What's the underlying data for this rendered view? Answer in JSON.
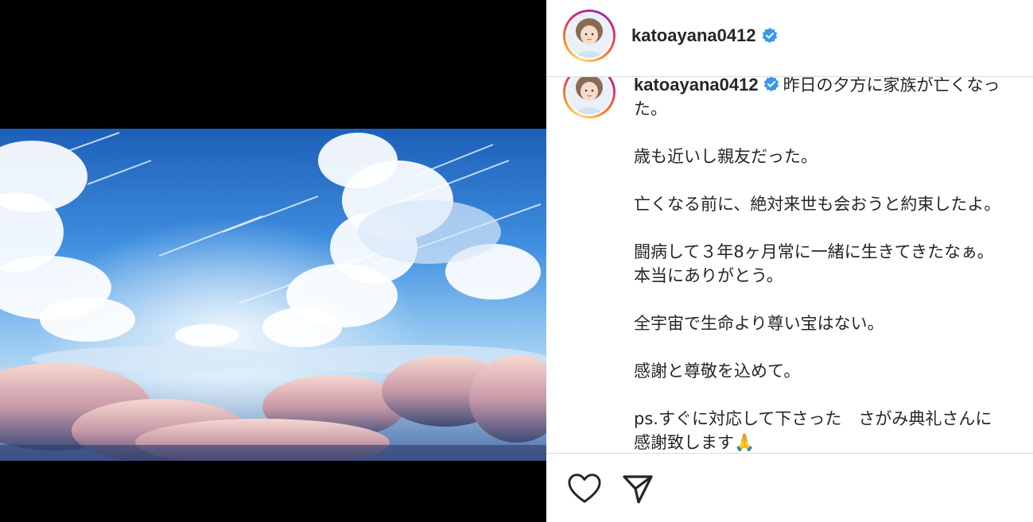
{
  "post": {
    "username": "katoayana0412",
    "verified": true,
    "caption": {
      "first_line_start": "昨日の夕方に家族が亡くなっ",
      "first_line_end": "た。",
      "paragraphs": [
        [
          "歳も近いし親友だった。"
        ],
        [
          "亡くなる前に、絶対来世も会おうと約束したよ。"
        ],
        [
          "闘病して３年8ヶ月常に一緒に生きてきたなぁ。",
          "本当にありがとう。"
        ],
        [
          "全宇宙で生命より尊い宝はない。"
        ],
        [
          "感謝と尊敬を込めて。"
        ],
        [
          "ps.すぐに対応して下さった　さがみ典礼さんに",
          "感謝致します🙏"
        ]
      ]
    }
  },
  "media": {
    "description_icon": "sky-clouds-image"
  },
  "actions": {
    "like_icon": "heart-icon",
    "share_icon": "paper-plane-icon"
  },
  "colors": {
    "verified": "#3897f0",
    "text": "#262626",
    "divider": "#dbdbdb"
  }
}
